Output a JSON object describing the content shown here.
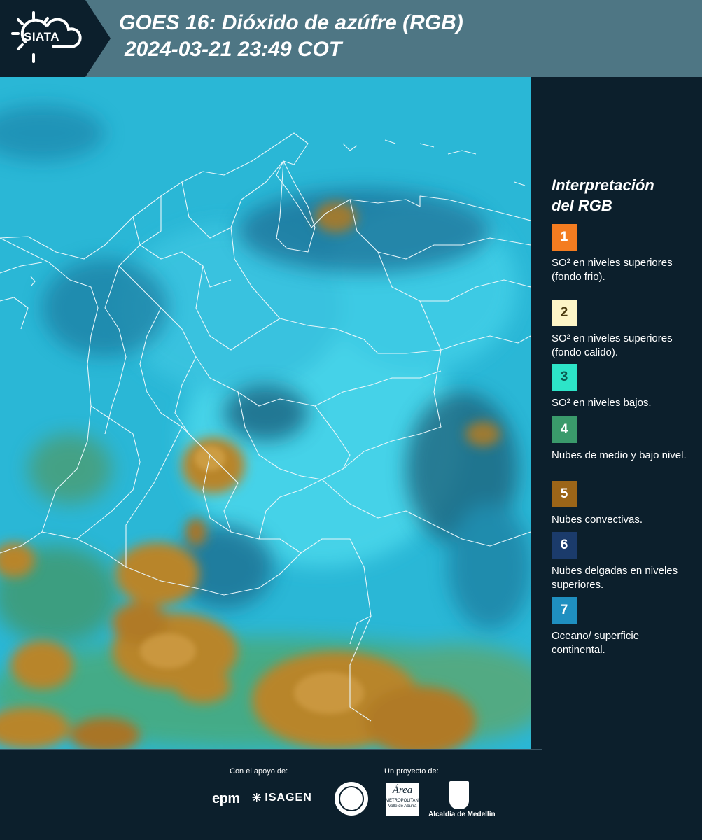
{
  "header": {
    "logo_text": "SIATA",
    "title_line1": "GOES 16: Dióxido de azúfre (RGB)",
    "title_line2": "2024-03-21 23:49 COT"
  },
  "legend": {
    "title_line1": "Interpretación",
    "title_line2": "del RGB",
    "items": [
      {
        "num": "1",
        "color": "#f47c20",
        "num_color": "#ffffff",
        "text": "SO² en niveles superiores (fondo frio)."
      },
      {
        "num": "2",
        "color": "#fdf5c7",
        "num_color": "#4a3b10",
        "text": "SO² en niveles superiores (fondo calido)."
      },
      {
        "num": "3",
        "color": "#2de4c8",
        "num_color": "#0c5a50",
        "text": "SO² en niveles bajos."
      },
      {
        "num": "4",
        "color": "#3a9a6b",
        "num_color": "#ffffff",
        "text": "Nubes de medio y bajo nivel."
      },
      {
        "num": "5",
        "color": "#9c6518",
        "num_color": "#ffffff",
        "text": "Nubes convectivas."
      },
      {
        "num": "6",
        "color": "#1b3b6b",
        "num_color": "#ffffff",
        "text": "Nubes delgadas en niveles superiores."
      },
      {
        "num": "7",
        "color": "#1f8fc0",
        "num_color": "#ffffff",
        "text": "Oceano/ superficie continental."
      }
    ]
  },
  "footer": {
    "support_label": "Con el apoyo de:",
    "project_label": "Un proyecto de:",
    "epm_text": "epm",
    "isagen_text": "ISAGEN",
    "area_text": "Área",
    "area_sub": "METROPOLITANA Valle de Aburrá",
    "alcaldia_text": "Alcaldía de Medellín"
  },
  "colors": {
    "background": "#0c1f2c",
    "header": "#4e7684",
    "ocean": "#2ab7d6",
    "convective": "#b8852a"
  }
}
